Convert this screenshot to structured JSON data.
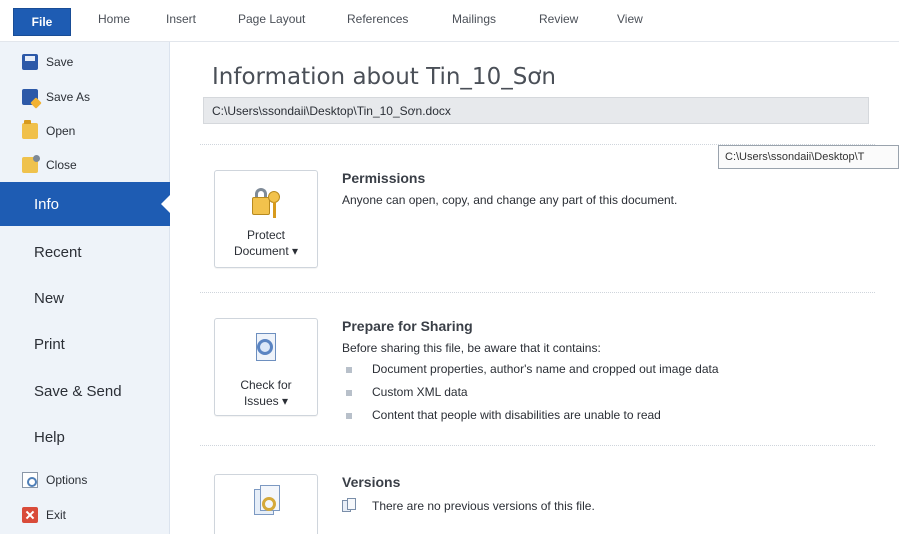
{
  "ribbon": {
    "tabs": [
      "File",
      "Home",
      "Insert",
      "Page Layout",
      "References",
      "Mailings",
      "Review",
      "View"
    ]
  },
  "sidebar": {
    "commands_top": [
      {
        "label": "Save",
        "icon": "save-icon"
      },
      {
        "label": "Save As",
        "icon": "save-as-icon"
      },
      {
        "label": "Open",
        "icon": "open-folder-icon"
      },
      {
        "label": "Close",
        "icon": "close-folder-icon"
      }
    ],
    "nav": [
      "Info",
      "Recent",
      "New",
      "Print",
      "Save & Send",
      "Help"
    ],
    "active": "Info",
    "commands_bottom": [
      {
        "label": "Options",
        "icon": "options-icon"
      },
      {
        "label": "Exit",
        "icon": "exit-icon"
      }
    ]
  },
  "main": {
    "title": "Information about Tin_10_Sơn",
    "path": "C:\\Users\\ssondaii\\Desktop\\Tin_10_Sơn.docx",
    "tooltip": "C:\\Users\\ssondaii\\Desktop\\T",
    "permissions": {
      "button_line1": "Protect",
      "button_line2": "Document ▾",
      "heading": "Permissions",
      "text": "Anyone can open, copy, and change any part of this document."
    },
    "sharing": {
      "button_line1": "Check for",
      "button_line2": "Issues ▾",
      "heading": "Prepare for Sharing",
      "text": "Before sharing this file, be aware that it contains:",
      "items": [
        "Document properties, author's name and cropped out image data",
        "Custom XML data",
        "Content that people with disabilities are unable to read"
      ]
    },
    "versions": {
      "heading": "Versions",
      "text": "There are no previous versions of this file."
    }
  },
  "colors": {
    "accent": "#1e5cb3",
    "sidebar_bg": "#eef3f9"
  }
}
